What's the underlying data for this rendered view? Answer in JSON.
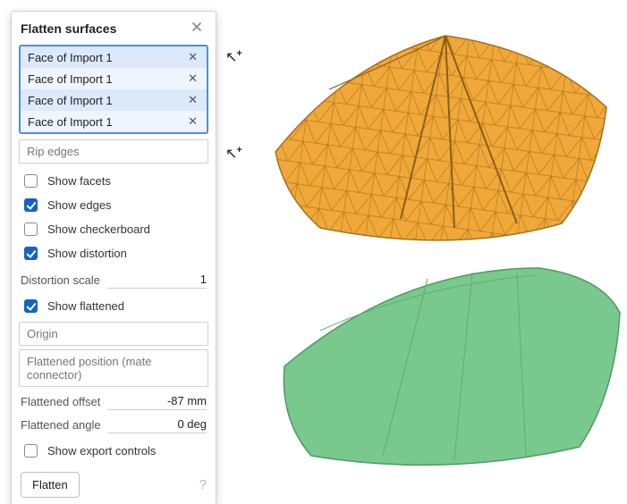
{
  "panel": {
    "title": "Flatten surfaces",
    "faces": [
      {
        "label": "Face of Import 1"
      },
      {
        "label": "Face of Import 1"
      },
      {
        "label": "Face of Import 1"
      },
      {
        "label": "Face of Import 1"
      }
    ],
    "rip_edges_placeholder": "Rip edges",
    "options": {
      "show_facets": {
        "label": "Show facets",
        "checked": false
      },
      "show_edges": {
        "label": "Show edges",
        "checked": true
      },
      "show_checkerboard": {
        "label": "Show checkerboard",
        "checked": false
      },
      "show_distortion": {
        "label": "Show distortion",
        "checked": true
      },
      "show_flattened": {
        "label": "Show flattened",
        "checked": true
      },
      "show_export": {
        "label": "Show export controls",
        "checked": false
      }
    },
    "distortion_scale": {
      "label": "Distortion scale",
      "value": "1"
    },
    "origin_placeholder": "Origin",
    "flattened_position_placeholder": "Flattened position (mate connector)",
    "flattened_offset": {
      "label": "Flattened offset",
      "value": "-87 mm"
    },
    "flattened_angle": {
      "label": "Flattened angle",
      "value": "0 deg"
    },
    "flatten_button": "Flatten"
  },
  "viewport": {
    "source_color": "#f0a838",
    "source_edge": "#a46f1f",
    "flattened_color": "#79c88d",
    "flattened_edge": "#4f9a63"
  }
}
